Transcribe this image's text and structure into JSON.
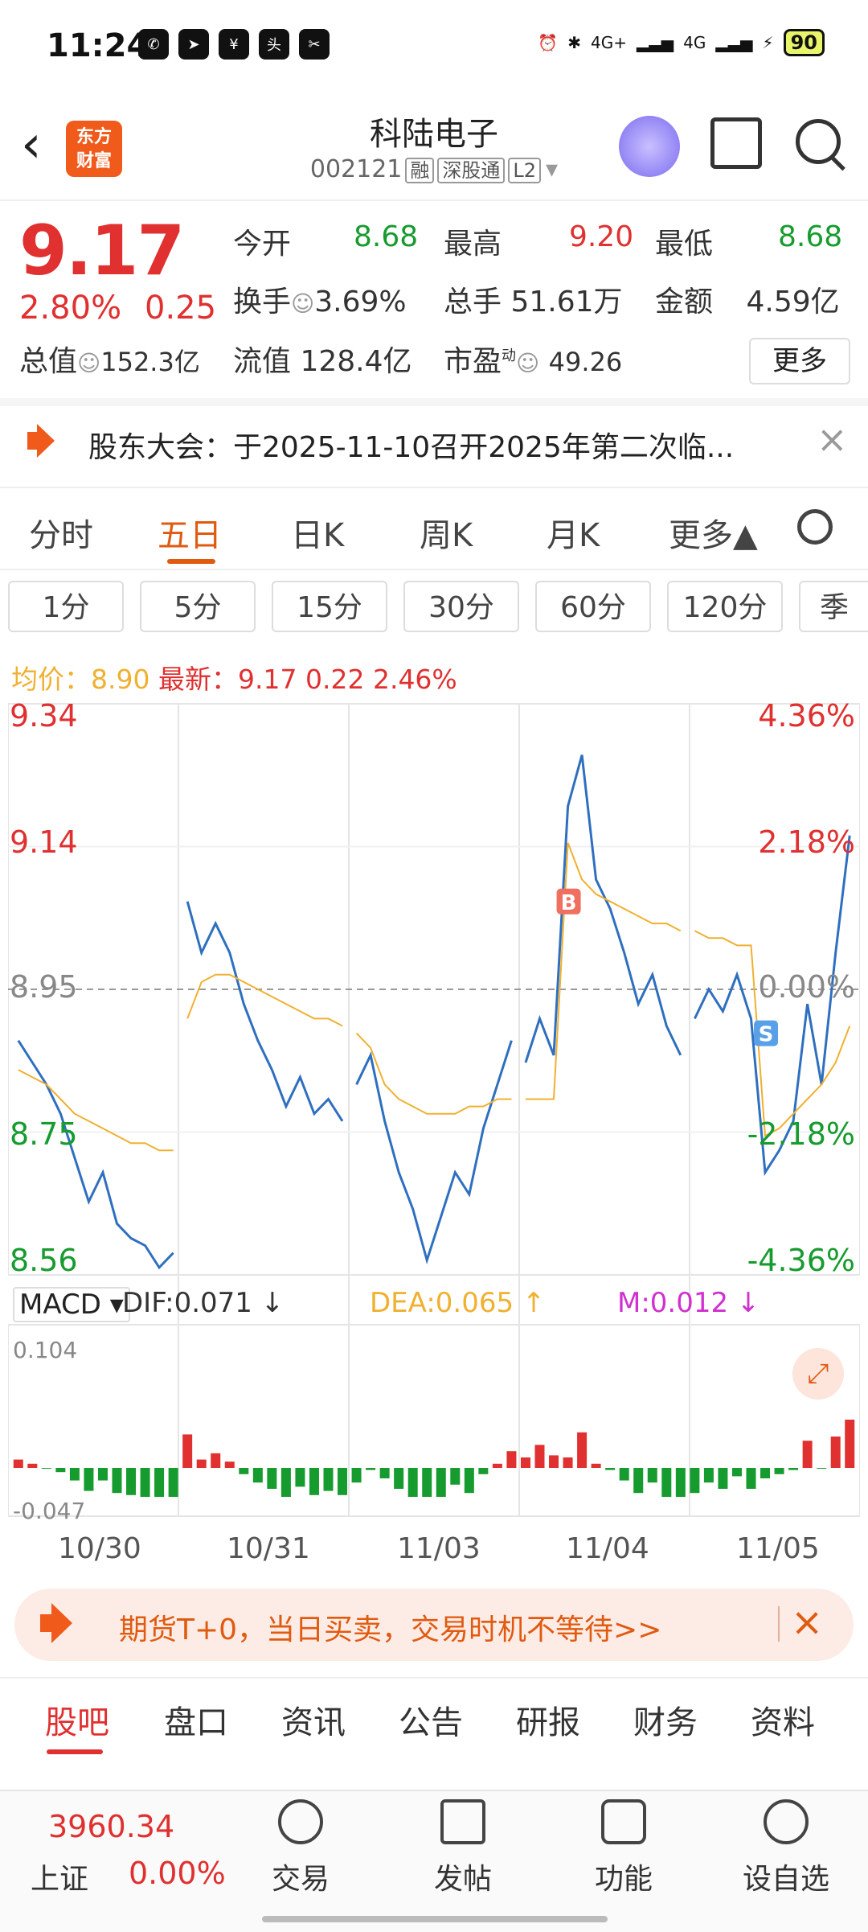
{
  "status": {
    "time": "11:24",
    "battery": "90",
    "signal_1": "4G+",
    "signal_2": "4G"
  },
  "header": {
    "back_label": "<",
    "logo_text": "东方\n财富",
    "stock_name": "科陆电子",
    "stock_code": "002121",
    "tags": [
      "融",
      "深股通",
      "L2"
    ]
  },
  "quote": {
    "price": "9.17",
    "change_pct": "2.80%",
    "change_amt": "0.25",
    "total_cap_label": "总值",
    "total_cap_value": "152.3亿",
    "open_label": "今开",
    "open_value": "8.68",
    "high_label": "最高",
    "high_value": "9.20",
    "low_label": "最低",
    "low_value": "8.68",
    "turnover_label": "换手",
    "turnover_value": "3.69%",
    "volume_label": "总手",
    "volume_value": "51.61万",
    "amount_label": "金额",
    "amount_value": "4.59亿",
    "float_cap_label": "流值",
    "float_cap_value": "128.4亿",
    "pe_label": "市盈",
    "pe_super": "动",
    "pe_value": "49.26",
    "more_label": "更多"
  },
  "notice": {
    "text": "股东大会：于2025-11-10召开2025年第二次临..."
  },
  "period_tabs": [
    "分时",
    "五日",
    "日K",
    "周K",
    "月K",
    "更多▲"
  ],
  "period_active": "五日",
  "minute_buttons": [
    "1分",
    "5分",
    "15分",
    "30分",
    "60分",
    "120分",
    "季"
  ],
  "avg_line": {
    "avg_label": "均价：",
    "avg_value": "8.90",
    "latest_label": "最新：",
    "latest_value": "9.17",
    "latest_change": "0.22",
    "latest_pct": "2.46%"
  },
  "chart_data": {
    "type": "line",
    "title": "",
    "x_labels": [
      "10/30",
      "10/31",
      "11/03",
      "11/04",
      "11/05"
    ],
    "y_left_ticks": [
      "9.34",
      "9.14",
      "8.95",
      "8.75",
      "8.56"
    ],
    "y_right_ticks": [
      "4.36%",
      "2.18%",
      "0.00%",
      "-2.18%",
      "-4.36%"
    ],
    "ylim": [
      8.56,
      9.34
    ],
    "prev_close": 8.95,
    "series": [
      {
        "values": [
          8.88,
          8.85,
          8.82,
          8.78,
          8.72,
          8.66,
          8.7,
          8.63,
          8.61,
          8.6,
          8.57,
          8.59,
          9.07,
          9.0,
          9.04,
          9.0,
          8.93,
          8.88,
          8.84,
          8.79,
          8.83,
          8.78,
          8.8,
          8.77,
          8.82,
          8.86,
          8.77,
          8.7,
          8.65,
          8.58,
          8.64,
          8.7,
          8.67,
          8.76,
          8.82,
          8.88,
          8.85,
          8.91,
          8.86,
          9.2,
          9.27,
          9.1,
          9.06,
          9.0,
          8.93,
          8.97,
          8.9,
          8.86,
          8.91,
          8.95,
          8.92,
          8.97,
          8.91,
          8.7,
          8.73,
          8.77,
          8.93,
          8.82,
          9.0,
          9.16
        ]
      },
      {
        "values": [
          8.84,
          8.83,
          8.82,
          8.8,
          8.78,
          8.77,
          8.76,
          8.75,
          8.74,
          8.74,
          8.73,
          8.73,
          8.91,
          8.96,
          8.97,
          8.97,
          8.96,
          8.95,
          8.94,
          8.93,
          8.92,
          8.91,
          8.91,
          8.9,
          8.89,
          8.87,
          8.82,
          8.8,
          8.79,
          8.78,
          8.78,
          8.78,
          8.79,
          8.79,
          8.8,
          8.8,
          8.8,
          8.8,
          8.8,
          9.15,
          9.1,
          9.08,
          9.07,
          9.06,
          9.05,
          9.04,
          9.04,
          9.03,
          9.03,
          9.02,
          9.02,
          9.01,
          9.01,
          8.75,
          8.76,
          8.78,
          8.8,
          8.82,
          8.85,
          8.9
        ]
      }
    ],
    "markers": [
      {
        "label": "B",
        "value": 9.07
      },
      {
        "label": "S",
        "value": 8.89
      }
    ]
  },
  "macd": {
    "label": "MACD",
    "dif": "DIF:0.071 ↓",
    "dea": "DEA:0.065 ↑",
    "m": "M:0.012 ↓",
    "top": "0.104",
    "bottom": "-0.047"
  },
  "banner": {
    "text": "期货T+0，当日买卖，交易时机不等待>>"
  },
  "bottom_tabs": [
    "股吧",
    "盘口",
    "资讯",
    "公告",
    "研报",
    "财务",
    "资料"
  ],
  "bottom_tab_active": "股吧",
  "index": {
    "value": "3960.34",
    "name": "上证",
    "change": "0.00%"
  },
  "nav": [
    {
      "label": "交易",
      "icon": "trade-icon"
    },
    {
      "label": "发帖",
      "icon": "post-icon"
    },
    {
      "label": "功能",
      "icon": "function-icon"
    },
    {
      "label": "设自选",
      "icon": "add-favorite-icon"
    }
  ],
  "colors": {
    "up": "#e03030",
    "down": "#169b2e",
    "accent": "#e05a10",
    "avg_line": "#f0b030",
    "price_line": "#2f6fbf"
  }
}
